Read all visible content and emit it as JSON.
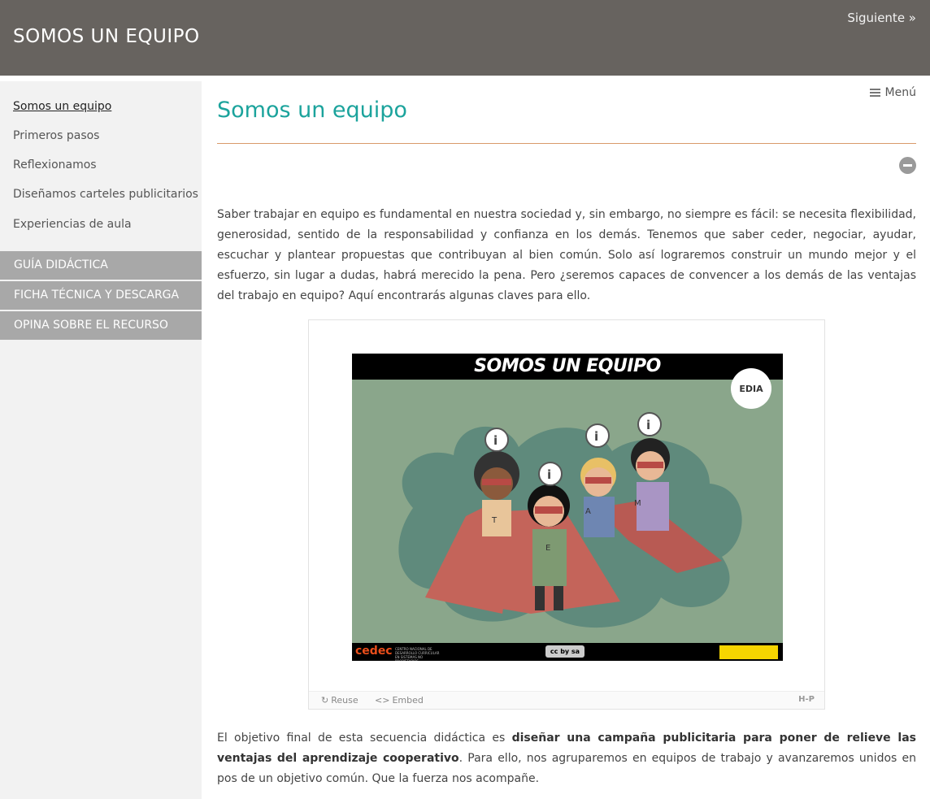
{
  "header": {
    "site_title": "SOMOS UN EQUIPO",
    "next_label": "Siguiente »"
  },
  "sidebar": {
    "items": [
      {
        "label": "Somos un equipo"
      },
      {
        "label": "Primeros pasos"
      },
      {
        "label": "Reflexionamos"
      },
      {
        "label": "Diseñamos carteles publicitarios"
      },
      {
        "label": "Experiencias de aula"
      }
    ],
    "sections": [
      {
        "label": "GUÍA DIDÁCTICA"
      },
      {
        "label": "FICHA TÉCNICA Y DESCARGA"
      },
      {
        "label": "OPINA SOBRE EL RECURSO"
      }
    ]
  },
  "main": {
    "menu_label": "Menú",
    "title": "Somos un equipo",
    "intro": "Saber trabajar en equipo es fundamental en nuestra sociedad y, sin embargo, no siempre es fácil: se necesita flexibilidad, generosidad, sentido de la responsabilidad y confianza en los demás. Tenemos que saber ceder, negociar, ayudar, escuchar y plantear propuestas que contribuyan al bien común. Solo así lograremos construir un mundo mejor y el esfuerzo, sin lugar a dudas, habrá merecido la pena. Pero ¿seremos capaces de convencer a los demás de las ventajas del trabajo en equipo? Aquí encontrarás algunas claves para ello.",
    "outro_start": "El objetivo final de esta secuencia didáctica es ",
    "outro_bold": "diseñar una campaña publicitaria para poner de relieve las ventajas del aprendizaje cooperativo",
    "outro_end": ". Para ello, nos agruparemos en equipos de trabajo y avanzaremos unidos en pos de un objetivo común. Que la fuerza nos acompañe."
  },
  "h5p": {
    "slide_title": "SOMOS UN EQUIPO",
    "logo_text": "EDIA",
    "footer_logo": "cedec",
    "footer_logo_sub": "CENTRO NACIONAL DE DESARROLLO CURRICULAR EN SISTEMAS NO PROPIETARIOS",
    "license_badge": "cc by sa",
    "hotspot_icon": "info-icon",
    "hotspot_letters": [
      "T",
      "E",
      "A",
      "M"
    ],
    "reuse_label": "Reuse",
    "embed_label": "Embed",
    "brand_mark": "H-P",
    "colors": {
      "background": "#8aa68b",
      "cloud": "#5f8a7c",
      "cape": "#c4645a"
    }
  }
}
